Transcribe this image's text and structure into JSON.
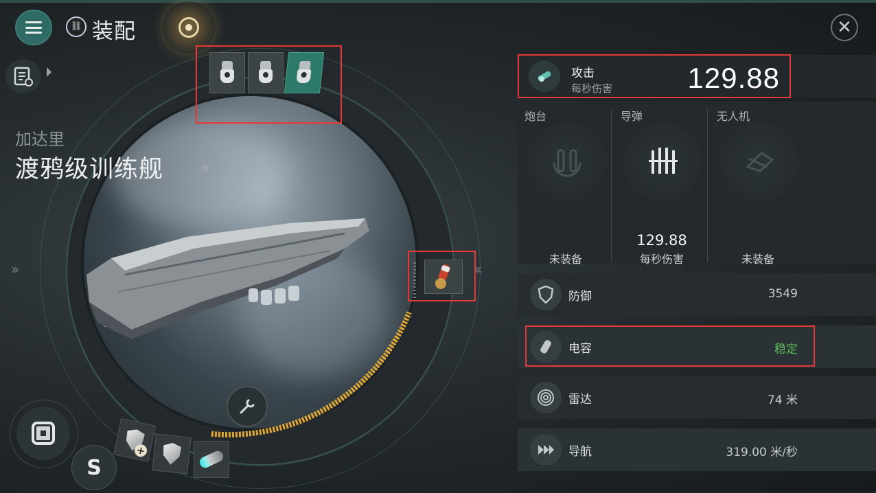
{
  "header": {
    "title": "装配",
    "title_icon_text": "ⓘ",
    "close_icon": "close-icon",
    "menu_icon": "hamburger-icon",
    "fitting_icon": "fitting-list-icon"
  },
  "ship": {
    "faction": "加达里",
    "name": "渡鸦级训练舰",
    "name_arrow": "»",
    "side_chevrons": "»",
    "mid_chevrons": "«"
  },
  "slots": {
    "high": [
      {
        "name": "turret-1",
        "active": false
      },
      {
        "name": "turret-2",
        "active": false
      },
      {
        "name": "turret-3",
        "active": true
      }
    ],
    "mid": [
      {
        "name": "capacitor-booster",
        "icon": "capacitor-charge-icon"
      }
    ],
    "low": [
      {
        "name": "shield-add",
        "icon": "shield-plus-icon"
      },
      {
        "name": "shield",
        "icon": "shield-icon"
      },
      {
        "name": "afterburner",
        "icon": "booster-icon"
      }
    ]
  },
  "stats": {
    "attack": {
      "label": "攻击",
      "sublabel": "每秒伤害",
      "value": "129.88"
    },
    "weapons": [
      {
        "label": "炮台",
        "status": "未装备",
        "icon": "turret-icon"
      },
      {
        "label": "导弹",
        "value": "129.88",
        "sublabel": "每秒伤害",
        "icon": "missile-icon"
      },
      {
        "label": "无人机",
        "status": "未装备",
        "icon": "drone-icon"
      }
    ],
    "defense": {
      "label": "防御",
      "value": "3549",
      "icon": "shield-icon"
    },
    "capacitor": {
      "label": "电容",
      "value": "稳定",
      "icon": "battery-icon"
    },
    "radar": {
      "label": "雷达",
      "value": "74 米",
      "icon": "radar-icon"
    },
    "navigation": {
      "label": "导航",
      "value": "319.00 米/秒",
      "icon": "speed-icon"
    }
  },
  "colors": {
    "accent": "#2d7a6a",
    "highlight": "#e53935",
    "stable": "#5fbf5e",
    "gauge": "#e0a832"
  }
}
